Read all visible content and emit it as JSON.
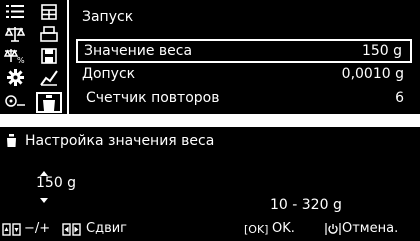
{
  "menu": {
    "title": "Запуск",
    "rows": [
      {
        "label": "Значение веса",
        "value": "150 g",
        "selected": true
      },
      {
        "label": "Допуск",
        "value": "0,0010 g"
      },
      {
        "label": "Счетчик повторов",
        "value": "6"
      }
    ]
  },
  "rail_icons": [
    "list-icon",
    "calculator-icon",
    "balance-icon",
    "printer-icon",
    "balance-percent-icon",
    "save-icon",
    "gear-icon",
    "chart-icon",
    "settings-toggle-icon",
    "weight-icon"
  ],
  "editor": {
    "title": "Настройка значения веса",
    "value": "150 g",
    "range": "10 - 320 g",
    "hints": {
      "change_keys": "−/+",
      "shift_label": "Сдвиг",
      "ok_key": "[OK]",
      "ok_label": "OK.",
      "cancel_label": "Отмена."
    }
  }
}
